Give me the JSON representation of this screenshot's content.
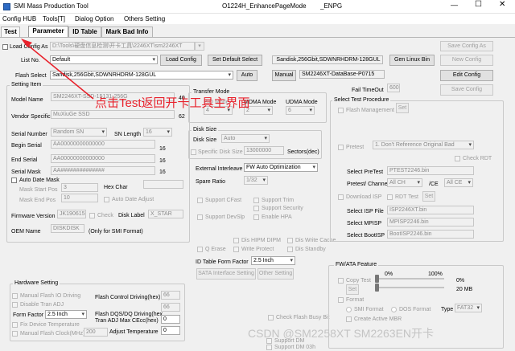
{
  "window": {
    "title": "SMI Mass Production Tool",
    "subtitle": "O1224H_EnhancePageMode",
    "code": "_ENPG"
  },
  "menu": [
    "Config HUB",
    "Tools[T]",
    "Dialog Option",
    "Others Setting"
  ],
  "tabs": [
    "Test",
    "Parameter",
    "ID Table",
    "Mark Bad Info"
  ],
  "top": {
    "load_config_as": "Load Config As",
    "config_path": "D:\\Tools\\硬盘信息检测\\开卡工具\\2246XT\\sm2246XT",
    "save_config_as": "Save Config As",
    "list_no": "List No.",
    "list_value": "Default",
    "load_config": "Load Config",
    "set_default_select": "Set Default Select",
    "flash_id": "Sandisk,256Gbit,SDWNRHDRM-128GUL",
    "gen_linux_bin": "Gen Linux Bin",
    "new_config": "New Config",
    "flash_select": "Flash Select",
    "flash_value": "Sandisk,256Gbit,SDWNRHDRM-128GUL",
    "auto": "Auto",
    "manual": "Manual",
    "database": "SM2246XT-DataBase-P0715",
    "edit_config": "Edit Config",
    "fail_timeout": "Fail TimeOut",
    "fail_timeout_value": "600",
    "save_config": "Save Config"
  },
  "setting_item": {
    "title": "Setting Item",
    "model_name": "Model Name",
    "model_value": "SM2246XT-SSD-15131-256G",
    "model_len": "40",
    "vendor_specific": "Vendor Specific",
    "vendor_value": "MuXiuGe SSD",
    "vendor_len": "62",
    "serial_number": "Serial Number",
    "serial_mode": "Random SN",
    "sn_length": "SN Length",
    "sn_length_value": "16",
    "begin_serial": "Begin Serial",
    "begin_value": "AA00000000000000",
    "begin_len": "16",
    "end_serial": "End Serial",
    "end_value": "AA00000000000000",
    "end_len": "16",
    "serial_mask": "Serial Mask",
    "mask_value": "AA##############",
    "mask_len": "16",
    "auto_date_mask": "Auto Date Mask",
    "mask_start_pos": "Mask Start Pos",
    "mask_start_value": "3",
    "hex_char": "Hex Char",
    "mask_end_pos": "Mask End Pos",
    "mask_end_value": "10",
    "auto_date_adjust": "Auto Date Adjust",
    "firmware_version": "Firmware Version",
    "firmware_value": "JK190615",
    "check": "Check",
    "disk_label": "Disk Label",
    "disk_label_value": "X_STAR",
    "oem_name": "OEM Name",
    "oem_value": "DISKDISK",
    "oem_note": "(Only for SMI Format)"
  },
  "transfer": {
    "title": "Transfer Mode",
    "pio": "PIO Mode",
    "pio_value": "4",
    "mdma": "MDMA Mode",
    "mdma_value": "2",
    "udma": "UDMA Mode",
    "udma_value": "6"
  },
  "disk_size": {
    "title": "Disk Size",
    "label": "Disk Size",
    "mode": "Auto",
    "specific": "Specific Disk Size",
    "sectors_value": "13000000",
    "sectors": "Sectors(dec)"
  },
  "ext_interleave": {
    "label": "External Interleave",
    "value": "FW Auto Optimization"
  },
  "spare_ratio": {
    "label": "Spare Ratio",
    "value": "1/32"
  },
  "features": {
    "support_cfast": "Support CFast",
    "support_trim": "Support Trim",
    "support_security": "Support Security",
    "support_devslp": "Support DevSlp",
    "enable_hpa": "Enable HPA",
    "dis_hipm_dipm": "Dis HIPM DIPM",
    "dis_write_cache": "Dis Write Cache",
    "q_erase": "Q Erase",
    "write_protect": "Write Protect",
    "dis_standby": "Dis Standby"
  },
  "id_table": {
    "label": "ID Table Form Factor",
    "value": "2.5 Inch",
    "sata_setting": "SATA Interface Setting",
    "other_setting": "Other Setting"
  },
  "hardware": {
    "title": "Hardware Setting",
    "manual_flash_io": "Manual Flash IO Driving",
    "disable_tran_adj": "Disable Tran ADJ",
    "form_factor": "Form Factor",
    "form_factor_value": "2.5 Inch",
    "fix_device_temp": "Fix Device Temperature",
    "manual_flash_clock": "Manual Flash Clock(MHz)",
    "clock_value": "200",
    "flash_control": "Flash Control Driving(hex)",
    "flash_control_value": "66",
    "flash_dqs": "Flash DQS/DQ Driving(hex",
    "flash_dqs_value": "66",
    "tran_adj": "Tran ADJ Max CEcc(hex)",
    "tran_adj_value": "0",
    "adjust_temp": "Adjust Temperature",
    "adjust_temp_value": "0",
    "check_flash_busy": "Check Flash Busy Bit",
    "support_dm": "Support DM",
    "support_dm03": "Support DM 03h"
  },
  "test_procedure": {
    "title": "Select Test Procedure",
    "flash_management": "Flash Management",
    "set": "Set",
    "pretest": "Pretest",
    "pretest_value": "1. Don't Reference Original Bad",
    "check_rdt": "Check RDT",
    "select_pretest": "Select PreTest",
    "pretest_file": "PTEST2246.bin",
    "pretest_ce": "Pretest/ Channel",
    "channel_value": "All CH",
    "ce_label": "/CE",
    "ce_value": "All CE",
    "download_isp": "Download ISP",
    "rdt_test": "RDT Test",
    "set2": "Set",
    "select_isp": "Select ISP File",
    "isp_file": "ISP2246XT.bin",
    "select_mpisp": "Select MPISP",
    "mpisp_file": "MPISP2246.bin",
    "select_bootisp": "Select BootISP",
    "bootisp_file": "BootISP2246.bin"
  },
  "fwata": {
    "title": "FW/ATA Feature",
    "pct_min": "0%",
    "pct_max": "100%",
    "copy_test": "Copy Test",
    "copy_pct": "0%",
    "set": "Set",
    "size": "20 MB",
    "format": "Format",
    "smi_format": "SMI Format",
    "dos_format": "DOS Format",
    "type": "Type",
    "type_value": "FAT32",
    "create_active_mbr": "Create Active MBR"
  },
  "annotation": {
    "text": "点击Test返回开卡工具主界面",
    "color": "#e8212b"
  },
  "watermark": "CSDN @SM2258XT SM2263EN开卡"
}
